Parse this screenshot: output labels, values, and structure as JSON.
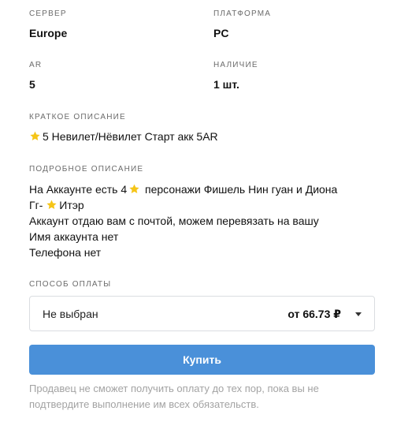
{
  "info": {
    "server_label": "СЕРВЕР",
    "server_value": "Europe",
    "platform_label": "ПЛАТФОРМА",
    "platform_value": "PC",
    "ar_label": "AR",
    "ar_value": "5",
    "quantity_label": "НАЛИЧИЕ",
    "quantity_value": "1 шт."
  },
  "short_description": {
    "label": "КРАТКОЕ ОПИСАНИЕ",
    "text": "5 Невилет/Нёвилет Старт акк 5AR",
    "icon": "star-icon"
  },
  "full_description": {
    "label": "ПОДРОБНОЕ ОПИСАНИЕ",
    "line1_before": "На Аккаунте есть 4",
    "line1_after": " персонажи Фишель Нин гуан и Диона",
    "line2_before": "Гг- ",
    "line2_after": "Итэр",
    "line3": "Аккаунт отдаю вам с почтой, можем перевязать на вашу",
    "line4": "Имя аккаунта нет",
    "line5": "Телефона нет",
    "icon": "star-icon"
  },
  "payment": {
    "label": "СПОСОБ ОПЛАТЫ",
    "selected": "Не выбран",
    "price": "от 66.73 ₽"
  },
  "buy_button": "Купить",
  "note": "Продавец не сможет получить оплату до тех пор, пока вы не подтвердите выполнение им всех обязательств.",
  "colors": {
    "accent": "#4a90d9",
    "star": "#f5c518"
  }
}
